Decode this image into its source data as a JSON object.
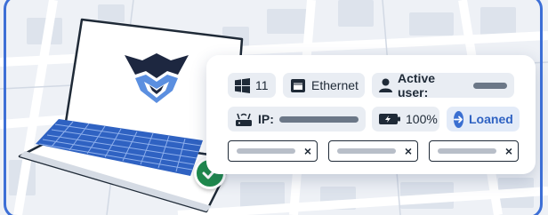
{
  "colors": {
    "frame": "#3d6fd6",
    "accent": "#3a6fd1",
    "success": "#1f8a4c",
    "logo_dark": "#1d2740",
    "logo_blue": "#5b8fe0"
  },
  "laptop": {
    "screen_logo_icon": "eagle-shield-logo",
    "status_icon": "checkmark-icon"
  },
  "device": {
    "os_icon": "windows-icon",
    "os_version": "11",
    "network_icon": "ethernet-icon",
    "network": "Ethernet",
    "user_icon": "user-icon",
    "active_user_label": "Active user:",
    "ip_icon": "router-icon",
    "ip_label": "IP:",
    "battery_icon": "battery-icon",
    "battery": "100%",
    "loan_icon": "arrow-right-circle-icon",
    "loan_status": "Loaned"
  },
  "fields": {
    "clear_symbol": "×",
    "count": 3
  }
}
